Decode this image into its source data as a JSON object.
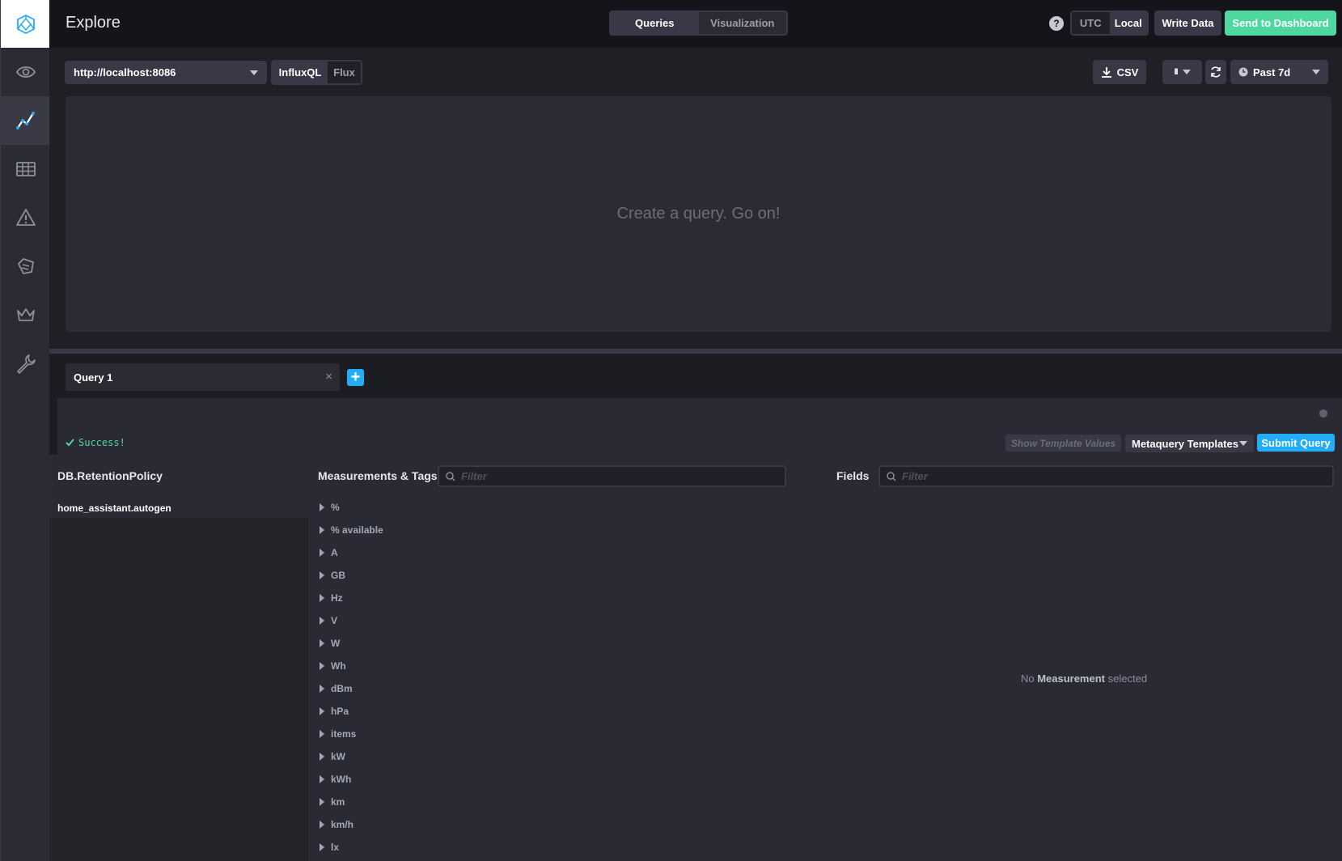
{
  "header": {
    "title": "Explore",
    "mode_tabs": [
      "Queries",
      "Visualization"
    ],
    "help_label": "?",
    "tz_options": [
      "UTC",
      "Local"
    ],
    "write_data_label": "Write Data",
    "send_label": "Send to Dashboard"
  },
  "toolbar": {
    "source": "http://localhost:8086",
    "languages": [
      "InfluxQL",
      "Flux"
    ],
    "csv_label": "CSV",
    "pause_label": "II",
    "time_range": "Past 7d"
  },
  "graph": {
    "placeholder": "Create a query. Go on!"
  },
  "query": {
    "tab_label": "Query 1",
    "close_label": "×",
    "add_label": "+",
    "status": "Success!",
    "show_template_values": "Show Template Values",
    "metaquery_templates": "Metaquery Templates",
    "submit": "Submit Query"
  },
  "schema": {
    "db_header": "DB.RetentionPolicy",
    "db_items": [
      "home_assistant.autogen"
    ],
    "measurements_header": "Measurements & Tags",
    "measurements_filter_placeholder": "Filter",
    "measurements": [
      "%",
      "% available",
      "A",
      "GB",
      "Hz",
      "V",
      "W",
      "Wh",
      "dBm",
      "hPa",
      "items",
      "kW",
      "kWh",
      "km",
      "km/h",
      "lx"
    ],
    "fields_header": "Fields",
    "fields_filter_placeholder": "Filter",
    "no_measurement_prefix": "No",
    "no_measurement_bold": "Measurement",
    "no_measurement_suffix": "selected"
  },
  "colors": {
    "accent_green": "#4ed8a0",
    "accent_blue": "#22adf6",
    "background": "#1c1c23"
  },
  "nav": {
    "items": [
      "eye-icon",
      "explore-graph-icon",
      "dashboards-icon",
      "alert-icon",
      "tag-icon",
      "crown-icon",
      "wrench-icon"
    ],
    "active": "explore-graph-icon"
  }
}
